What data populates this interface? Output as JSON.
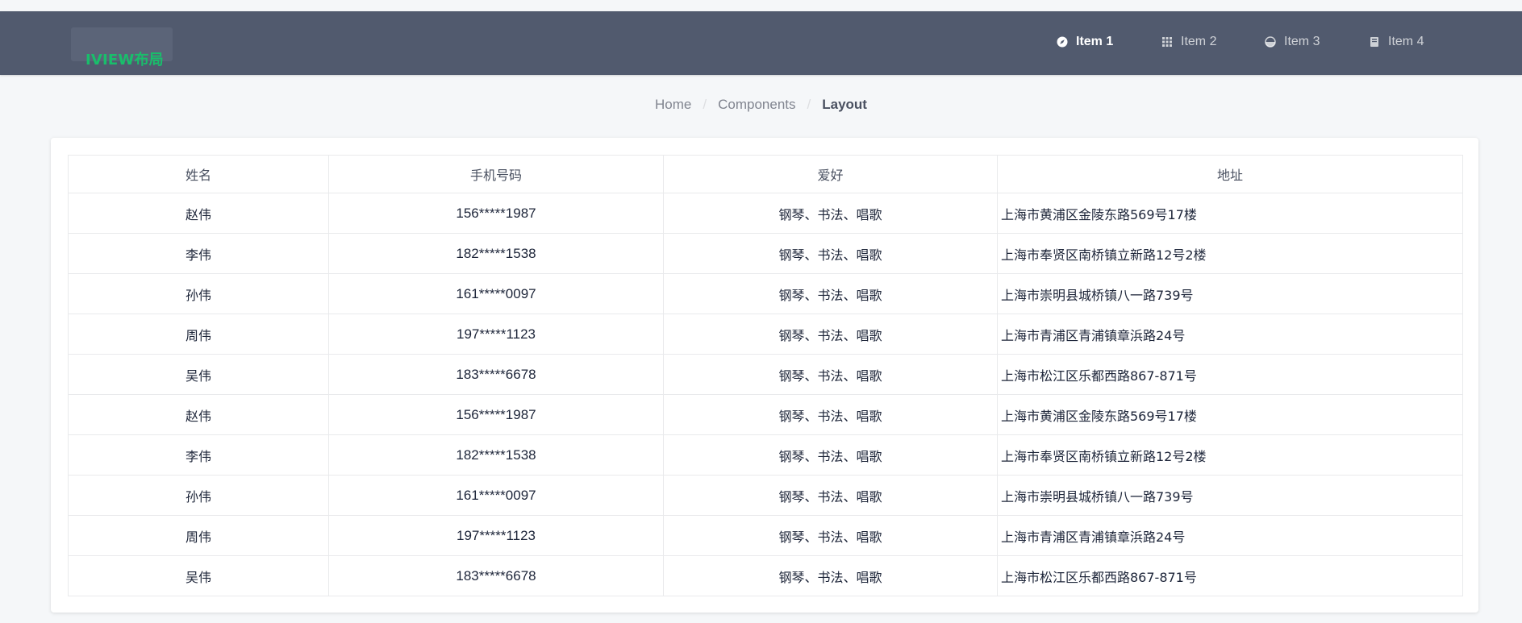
{
  "header": {
    "logo_text": "IVIEW布局",
    "menu": [
      {
        "label": "Item 1",
        "icon": "compass-icon",
        "active": true
      },
      {
        "label": "Item 2",
        "icon": "grid-icon",
        "active": false
      },
      {
        "label": "Item 3",
        "icon": "pie-icon",
        "active": false
      },
      {
        "label": "Item 4",
        "icon": "book-icon",
        "active": false
      }
    ]
  },
  "breadcrumb": {
    "items": [
      "Home",
      "Components",
      "Layout"
    ],
    "separator": "/"
  },
  "table": {
    "columns": [
      "姓名",
      "手机号码",
      "爱好",
      "地址"
    ],
    "rows": [
      [
        "赵伟",
        "156*****1987",
        "钢琴、书法、唱歌",
        "上海市黄浦区金陵东路569号17楼"
      ],
      [
        "李伟",
        "182*****1538",
        "钢琴、书法、唱歌",
        "上海市奉贤区南桥镇立新路12号2楼"
      ],
      [
        "孙伟",
        "161*****0097",
        "钢琴、书法、唱歌",
        "上海市崇明县城桥镇八一路739号"
      ],
      [
        "周伟",
        "197*****1123",
        "钢琴、书法、唱歌",
        "上海市青浦区青浦镇章浜路24号"
      ],
      [
        "吴伟",
        "183*****6678",
        "钢琴、书法、唱歌",
        "上海市松江区乐都西路867-871号"
      ],
      [
        "赵伟",
        "156*****1987",
        "钢琴、书法、唱歌",
        "上海市黄浦区金陵东路569号17楼"
      ],
      [
        "李伟",
        "182*****1538",
        "钢琴、书法、唱歌",
        "上海市奉贤区南桥镇立新路12号2楼"
      ],
      [
        "孙伟",
        "161*****0097",
        "钢琴、书法、唱歌",
        "上海市崇明县城桥镇八一路739号"
      ],
      [
        "周伟",
        "197*****1123",
        "钢琴、书法、唱歌",
        "上海市青浦区青浦镇章浜路24号"
      ],
      [
        "吴伟",
        "183*****6678",
        "钢琴、书法、唱歌",
        "上海市松江区乐都西路867-871号"
      ]
    ]
  },
  "colors": {
    "header_bg": "#515a6e",
    "logo_text": "#19be6b",
    "page_bg": "#f5f7f9",
    "border": "#e9eaec"
  }
}
